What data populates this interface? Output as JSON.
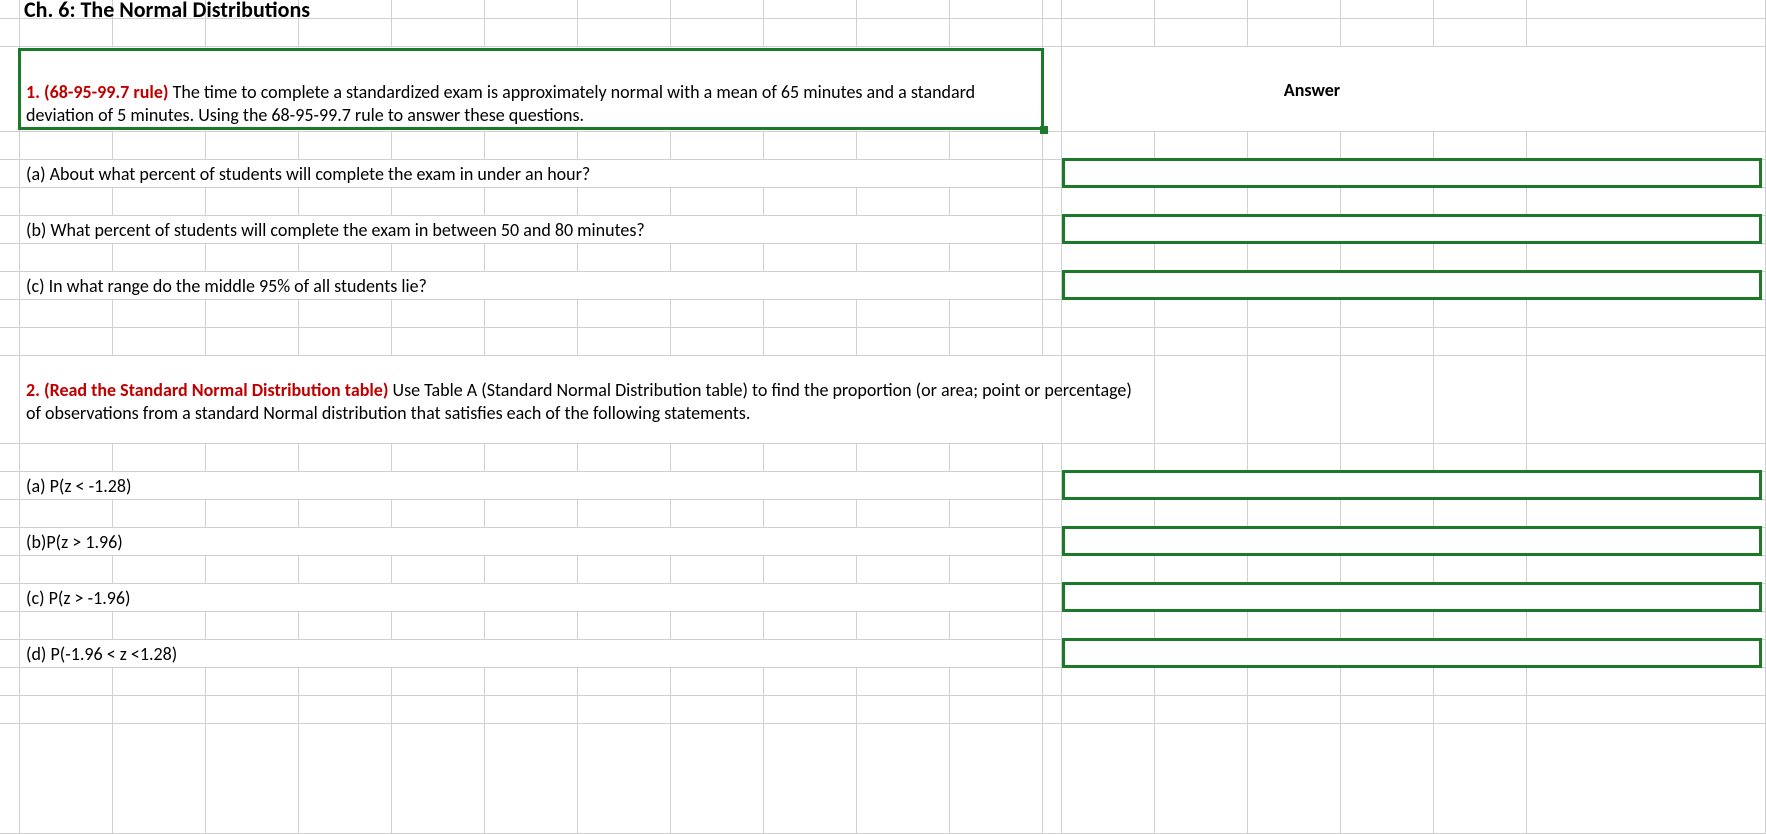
{
  "title": "Ch. 6: The Normal Distributions",
  "answerHeader": "Answer",
  "q1": {
    "label": "1. (68-95-99.7 rule) ",
    "text": "The time to complete a standardized exam is approximately normal with a mean of 65 minutes and a standard deviation of 5 minutes.  Using the 68-95-99.7 rule to answer these questions.",
    "a": "(a) About what percent of students will complete the exam in under an hour?",
    "b": "(b) What percent of students will complete the exam in between 50 and 80 minutes?",
    "c": "(c) In what range do the middle 95% of all students lie?"
  },
  "q2": {
    "label": "2. (Read the Standard Normal Distribution table)  ",
    "text": "Use Table A (Standard Normal Distribution table) to find the proportion (or area; point or percentage) of observations from a standard Normal distribution that satisfies each of the following statements.",
    "a": "(a) P(z < -1.28)",
    "b": "(b)P(z > 1.96)",
    "c": "(c) P(z > -1.96)",
    "d": "(d) P(-1.96 < z <1.28)"
  },
  "columns": [
    0,
    20,
    113,
    206,
    299,
    392,
    485,
    578,
    671,
    764,
    857,
    950,
    1043,
    1062,
    1155,
    1248,
    1341,
    1434,
    1527,
    1766
  ],
  "rows": [
    0,
    19,
    47,
    132,
    160,
    188,
    216,
    244,
    272,
    300,
    328,
    356,
    444,
    472,
    500,
    528,
    556,
    584,
    612,
    640,
    668,
    696,
    724,
    834
  ]
}
